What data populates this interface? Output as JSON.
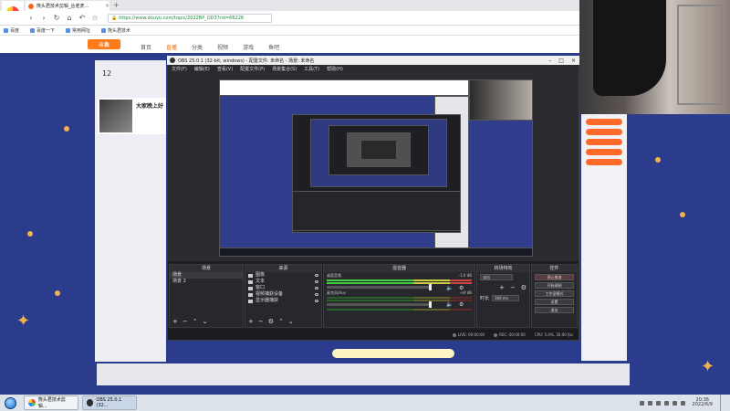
{
  "browser": {
    "logo_label": "",
    "tab": {
      "title": "熊头君技术剪辑_丛老虎..."
    },
    "new_tab_symbol": "+",
    "url": "https://www.douyu.com/topic/2022BP_QD3?rid=66226",
    "bookmarks": [
      "百度",
      "百度一下",
      "常用网址",
      "熊头君技术"
    ]
  },
  "site": {
    "logo": "斗鱼",
    "nav": [
      "首页",
      "直播",
      "分类",
      "视频",
      "游戏",
      "鱼吧"
    ],
    "follow_count": "12",
    "follow_label": "",
    "streamer_name": "大家晚上好",
    "announcement": ""
  },
  "obs": {
    "title": "OBS 25.0.1 (32-bit, windows) - 配置文件: 未命名 - 场景: 未命名",
    "menu": [
      "文件(F)",
      "编辑(E)",
      "查看(V)",
      "配置文件(P)",
      "场景集合(S)",
      "工具(T)",
      "帮助(H)"
    ],
    "docks": {
      "scenes": {
        "title": "场景",
        "items": [
          "场景",
          "场景 2"
        ]
      },
      "sources": {
        "title": "来源",
        "items": [
          "图像",
          "文本",
          "窗口",
          "视频捕获设备",
          "显示器捕获"
        ]
      },
      "mixer": {
        "title": "混音器",
        "tracks": [
          {
            "name": "桌面音频",
            "db": "-1.0 dB"
          },
          {
            "name": "麦克风/Aux",
            "db": "-inf dB"
          },
          {
            "name": "",
            "db": ""
          }
        ]
      },
      "transitions": {
        "title": "转场特效",
        "select": "淡出",
        "duration_label": "时长",
        "duration": "300 ms"
      },
      "controls": {
        "title": "控件",
        "buttons": [
          "停止推流",
          "开始录制",
          "工作室模式",
          "设置",
          "退出"
        ]
      }
    },
    "status": {
      "live": "LIVE: 00:00:00",
      "rec": "REC: 00:00:00",
      "cpu": "CPU: 5.0%, 30.00 fps"
    }
  },
  "taskbar": {
    "tasks": [
      {
        "label": "熊头君技术剪辑..."
      },
      {
        "label": "OBS 25.0.1 (32..."
      }
    ],
    "time": "20:36",
    "date": "2022/6/9"
  }
}
